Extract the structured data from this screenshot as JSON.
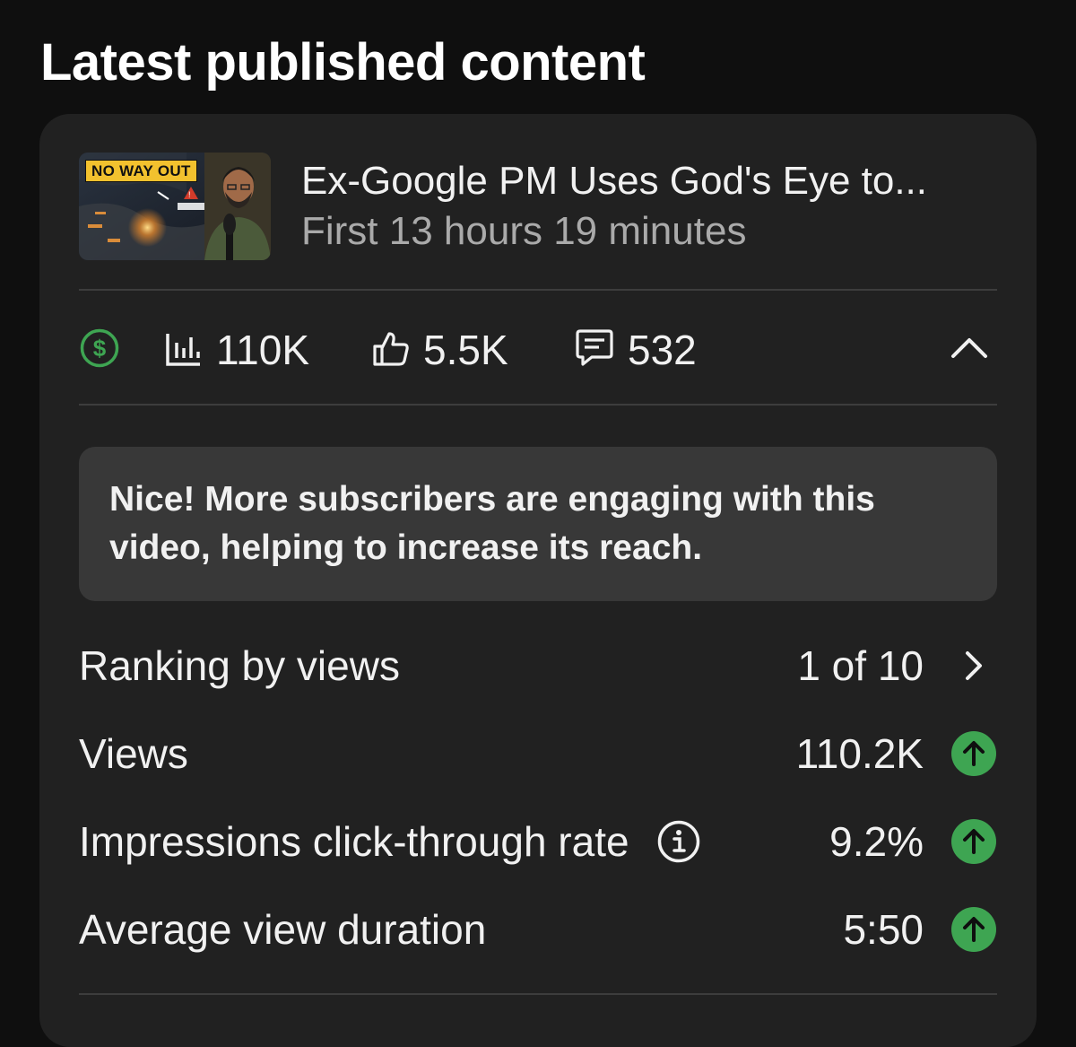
{
  "section_title": "Latest published content",
  "video": {
    "thumbnail_banner": "NO WAY OUT",
    "title": "Ex-Google PM Uses God's Eye to...",
    "subtitle": "First 13 hours 19 minutes"
  },
  "stats": {
    "views": "110K",
    "likes": "5.5K",
    "comments": "532"
  },
  "banner_message": "Nice! More subscribers are engaging with this video, helping to increase its reach.",
  "metrics": [
    {
      "label": "Ranking by views",
      "value": "1 of 10"
    },
    {
      "label": "Views",
      "value": "110.2K"
    },
    {
      "label": "Impressions click-through rate",
      "value": "9.2%"
    },
    {
      "label": "Average view duration",
      "value": "5:50"
    }
  ],
  "colors": {
    "accent_green": "#3ea552",
    "card_bg": "#212121",
    "banner_bg": "#383838"
  },
  "icons": {
    "monetization": "dollar-circle-icon",
    "views": "bar-chart-icon",
    "likes": "thumbs-up-icon",
    "comments": "comment-icon",
    "collapse": "chevron-up-icon",
    "next": "chevron-right-icon",
    "info": "info-icon",
    "trend": "arrow-up-circle-icon"
  }
}
